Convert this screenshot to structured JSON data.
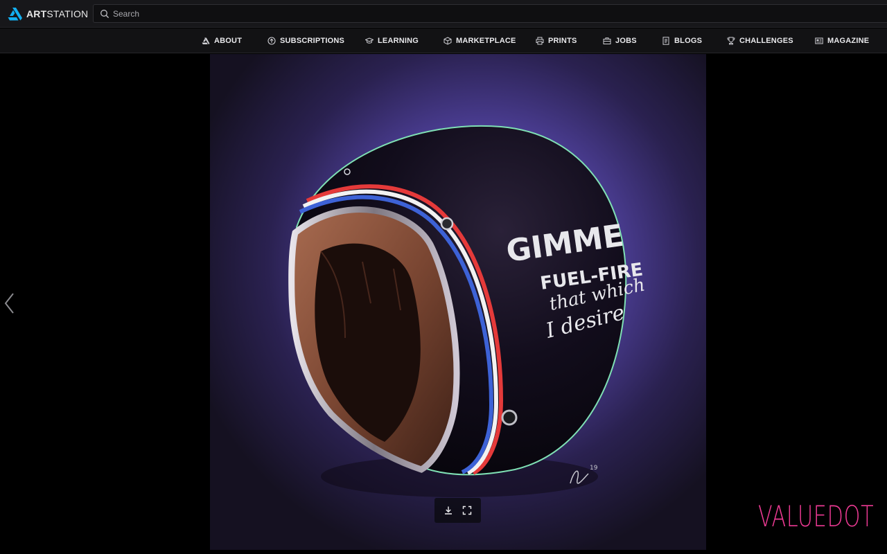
{
  "app": {
    "logo_bold": "ART",
    "logo_rest": "STATION",
    "brand_color": "#13aff0"
  },
  "search": {
    "placeholder": "Search",
    "value": ""
  },
  "nav": {
    "items": [
      {
        "label": "ABOUT",
        "icon": "artstation-small-icon"
      },
      {
        "label": "SUBSCRIPTIONS",
        "icon": "arrow-up-circle-icon"
      },
      {
        "label": "LEARNING",
        "icon": "graduation-cap-icon"
      },
      {
        "label": "MARKETPLACE",
        "icon": "box-icon"
      },
      {
        "label": "PRINTS",
        "icon": "printer-icon"
      },
      {
        "label": "JOBS",
        "icon": "briefcase-icon"
      },
      {
        "label": "BLOGS",
        "icon": "document-icon"
      },
      {
        "label": "CHALLENGES",
        "icon": "trophy-icon"
      },
      {
        "label": "MAGAZINE",
        "icon": "newspaper-icon"
      }
    ]
  },
  "artwork": {
    "helmet_text": [
      "GIMME",
      "FUEL-FIRE",
      "that which",
      "I desire"
    ],
    "signature": "19"
  },
  "viewer": {
    "controls": [
      "download-icon",
      "fullscreen-icon"
    ],
    "watermark": "VALUEDOT"
  }
}
